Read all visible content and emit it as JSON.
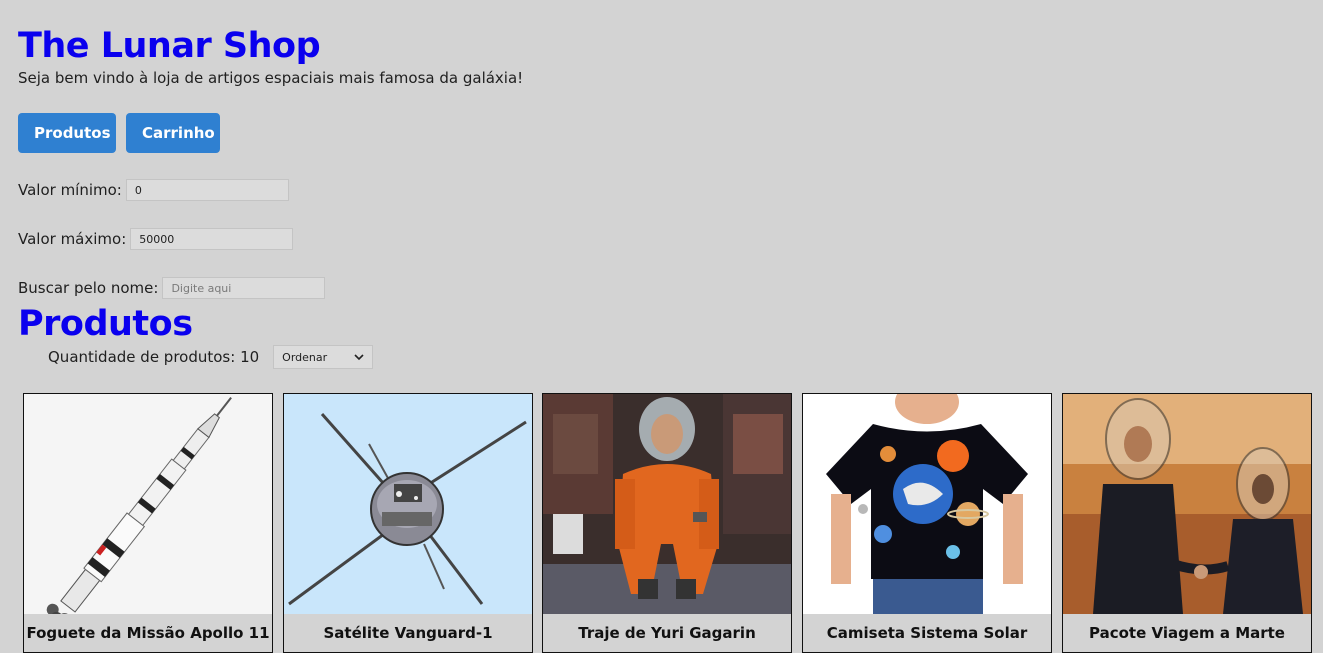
{
  "header": {
    "title": "The Lunar Shop",
    "subtitle": "Seja bem vindo à loja de artigos espaciais mais famosa da galáxia!"
  },
  "nav": {
    "produtos_label": "Produtos",
    "carrinho_label": "Carrinho"
  },
  "filters": {
    "min_label": "Valor mínimo:",
    "min_value": "0",
    "max_label": "Valor máximo:",
    "max_value": "50000",
    "search_label": "Buscar pelo nome:",
    "search_value": "",
    "search_placeholder": "Digite aqui"
  },
  "products": {
    "section_title": "Produtos",
    "count_label": "Quantidade de produtos: 10",
    "sort_label": "Ordenar",
    "items": [
      {
        "name": "Foguete da Missão Apollo 11",
        "image_icon": "rocket-image"
      },
      {
        "name": "Satélite Vanguard-1",
        "image_icon": "satellite-image"
      },
      {
        "name": "Traje de Yuri Gagarin",
        "image_icon": "spacesuit-image"
      },
      {
        "name": "Camiseta Sistema Solar",
        "image_icon": "solar-system-tshirt-image"
      },
      {
        "name": "Pacote Viagem a Marte",
        "image_icon": "mars-trip-image"
      }
    ]
  },
  "colors": {
    "background": "#d3d3d3",
    "title": "#0a00ee",
    "button": "#2f80d1"
  }
}
